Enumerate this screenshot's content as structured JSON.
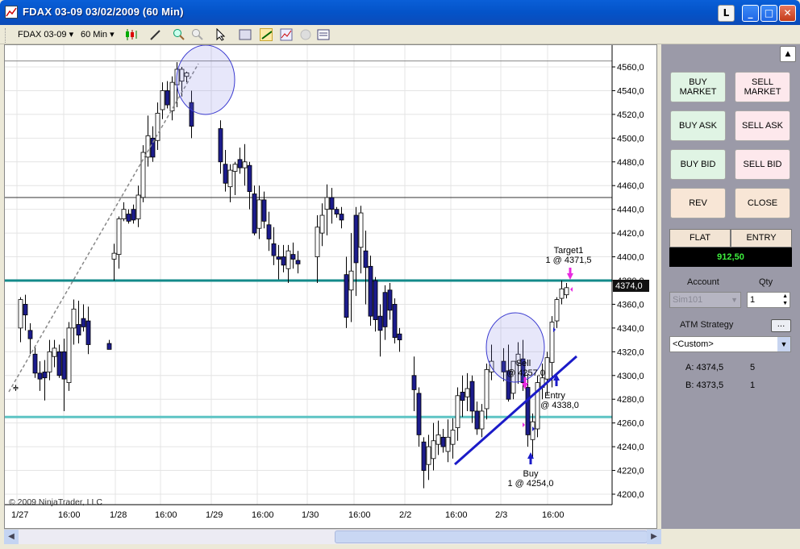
{
  "window": {
    "title": "FDAX 03-09  03/02/2009 (60 Min)",
    "lock_label": "L"
  },
  "toolbar": {
    "instrument": "FDAX 03-09",
    "interval": "60 Min"
  },
  "chart": {
    "copyright": "© 2009 NinjaTrader, LLC",
    "price_labels": [
      "4560,0",
      "4540,0",
      "4520,0",
      "4500,0",
      "4480,0",
      "4460,0",
      "4440,0",
      "4420,0",
      "4400,0",
      "4380,0",
      "4360,0",
      "4340,0",
      "4320,0",
      "4300,0",
      "4280,0",
      "4260,0",
      "4240,0",
      "4220,0",
      "4200,0"
    ],
    "last_price": "4374,0",
    "time_labels": [
      "1/27",
      "16:00",
      "1/28",
      "16:00",
      "1/29",
      "16:00",
      "1/30",
      "16:00",
      "2/2",
      "16:00",
      "2/3",
      "16:00"
    ],
    "annotations": {
      "target_l1": "Target1",
      "target_l2": "1 @ 4371,5",
      "sell_l1": "Sell",
      "sell_l2": "@ 4257,0",
      "entry_l1": "Entry",
      "entry_l2": "@ 4338,0",
      "buy_l1": "Buy",
      "buy_l2": "1 @ 4254,0"
    }
  },
  "chart_data": {
    "type": "candlestick",
    "ylim": [
      4195,
      4570
    ],
    "hlines": [
      4565,
      4450,
      4380,
      4265
    ],
    "candles": [
      [
        4289,
        4292,
        4287,
        4290
      ],
      [
        4340,
        4366,
        4328,
        4364
      ],
      [
        4360,
        4368,
        4338,
        4351
      ],
      [
        4338,
        4344,
        4318,
        4331
      ],
      [
        4318,
        4324,
        4298,
        4302
      ],
      [
        4302,
        4312,
        4287,
        4297
      ],
      [
        4303,
        4313,
        4279,
        4298
      ],
      [
        4303,
        4330,
        4296,
        4320
      ],
      [
        4316,
        4330,
        4307,
        4323
      ],
      [
        4320,
        4326,
        4298,
        4300
      ],
      [
        4320,
        4331,
        4270,
        4297
      ],
      [
        4294,
        4345,
        4287,
        4340
      ],
      [
        4340,
        4364,
        4326,
        4356
      ],
      [
        4343,
        4363,
        4327,
        4334
      ],
      [
        4348,
        4360,
        4337,
        4341
      ],
      [
        4346,
        4358,
        4318,
        4326
      ],
      [
        4327,
        4330,
        4322,
        4322
      ],
      [
        4398,
        4411,
        4380,
        4403
      ],
      [
        4402,
        4434,
        4390,
        4432
      ],
      [
        4432,
        4446,
        4430,
        4440
      ],
      [
        4436,
        4440,
        4428,
        4430
      ],
      [
        4440,
        4444,
        4428,
        4431
      ],
      [
        4432,
        4460,
        4425,
        4452
      ],
      [
        4450,
        4494,
        4446,
        4488
      ],
      [
        4484,
        4519,
        4476,
        4502
      ],
      [
        4500,
        4510,
        4480,
        4484
      ],
      [
        4498,
        4530,
        4490,
        4521
      ],
      [
        4524,
        4547,
        4516,
        4540
      ],
      [
        4540,
        4548,
        4525,
        4528
      ],
      [
        4523,
        4552,
        4515,
        4547
      ],
      [
        4545,
        4564,
        4526,
        4558
      ],
      [
        4548,
        4560,
        4535,
        4558
      ],
      [
        4552,
        4556,
        4547,
        4555
      ],
      [
        4530,
        4540,
        4500,
        4510
      ],
      [
        4508,
        4515,
        4470,
        4480
      ],
      [
        4478,
        4490,
        4455,
        4462
      ],
      [
        4459,
        4478,
        4446,
        4473
      ],
      [
        4472,
        4480,
        4452,
        4478
      ],
      [
        4482,
        4492,
        4470,
        4475
      ],
      [
        4475,
        4495,
        4460,
        4480
      ],
      [
        4477,
        4480,
        4440,
        4455
      ],
      [
        4453,
        4460,
        4418,
        4420
      ],
      [
        4424,
        4460,
        4415,
        4448
      ],
      [
        4448,
        4455,
        4424,
        4430
      ],
      [
        4427,
        4438,
        4405,
        4415
      ],
      [
        4411,
        4425,
        4393,
        4401
      ],
      [
        4400,
        4410,
        4381,
        4398
      ],
      [
        4400,
        4410,
        4387,
        4393
      ],
      [
        4390,
        4410,
        4378,
        4405
      ],
      [
        4402,
        4412,
        4390,
        4398
      ],
      [
        4397,
        4405,
        4386,
        4394
      ],
      [
        4400,
        4435,
        4378,
        4425
      ],
      [
        4420,
        4445,
        4409,
        4435
      ],
      [
        4440,
        4461,
        4418,
        4450
      ],
      [
        4450,
        4458,
        4428,
        4440
      ],
      [
        4440,
        4442,
        4433,
        4436
      ],
      [
        4436,
        4442,
        4424,
        4431
      ],
      [
        4385,
        4400,
        4340,
        4349
      ],
      [
        4372,
        4420,
        4345,
        4388
      ],
      [
        4435,
        4442,
        4367,
        4395
      ],
      [
        4408,
        4443,
        4386,
        4437
      ],
      [
        4405,
        4422,
        4360,
        4391
      ],
      [
        4392,
        4401,
        4342,
        4350
      ],
      [
        4380,
        4383,
        4337,
        4347
      ],
      [
        4350,
        4360,
        4316,
        4338
      ],
      [
        4370,
        4376,
        4330,
        4341
      ],
      [
        4372,
        4378,
        4347,
        4355
      ],
      [
        4360,
        4365,
        4327,
        4332
      ],
      [
        4335,
        4340,
        4320,
        4330
      ],
      [
        4300,
        4316,
        4270,
        4288
      ],
      [
        4285,
        4290,
        4240,
        4250
      ],
      [
        4244,
        4248,
        4205,
        4220
      ],
      [
        4225,
        4250,
        4212,
        4240
      ],
      [
        4230,
        4260,
        4220,
        4245
      ],
      [
        4242,
        4262,
        4233,
        4250
      ],
      [
        4248,
        4255,
        4235,
        4240
      ],
      [
        4236,
        4263,
        4227,
        4248
      ],
      [
        4242,
        4264,
        4230,
        4254
      ],
      [
        4256,
        4290,
        4245,
        4283
      ],
      [
        4286,
        4300,
        4265,
        4279
      ],
      [
        4282,
        4302,
        4270,
        4289
      ],
      [
        4295,
        4300,
        4260,
        4270
      ],
      [
        4270,
        4278,
        4250,
        4255
      ],
      [
        4255,
        4276,
        4248,
        4270
      ],
      [
        4272,
        4310,
        4263,
        4305
      ],
      [
        4303,
        4326,
        4296,
        4312
      ],
      [
        4312,
        4323,
        4295,
        4303
      ],
      [
        4304,
        4326,
        4278,
        4280
      ],
      [
        4285,
        4310,
        4280,
        4312
      ],
      [
        4310,
        4328,
        4293,
        4318
      ],
      [
        4314,
        4330,
        4287,
        4294
      ],
      [
        4290,
        4302,
        4240,
        4250
      ],
      [
        4246,
        4268,
        4230,
        4261
      ],
      [
        4255,
        4300,
        4248,
        4294
      ],
      [
        4290,
        4310,
        4280,
        4298
      ],
      [
        4297,
        4320,
        4284,
        4315
      ],
      [
        4311,
        4350,
        4290,
        4345
      ],
      [
        4346,
        4366,
        4340,
        4364
      ],
      [
        4365,
        4380,
        4360,
        4373
      ],
      [
        4368,
        4378,
        4365,
        4374
      ]
    ]
  },
  "panel": {
    "buy_market": [
      "BUY",
      "MARKET"
    ],
    "sell_market": [
      "SELL",
      "MARKET"
    ],
    "buy_ask": "BUY ASK",
    "sell_ask": "SELL ASK",
    "buy_bid": "BUY BID",
    "sell_bid": "SELL BID",
    "rev": "REV",
    "close": "CLOSE",
    "position": "FLAT",
    "entry": "ENTRY",
    "pnl": "912,50",
    "account_label": "Account",
    "qty_label": "Qty",
    "account_value": "Sim101",
    "qty_value": "1",
    "atm_label": "ATM Strategy",
    "atm_dots": "...",
    "atm_value": "<Custom>",
    "ask_label": "A: 4374,5",
    "ask_size": "5",
    "bid_label": "B: 4373,5",
    "bid_size": "1"
  },
  "colors": {
    "bear": "#1c1c8c",
    "bull": "#ffffff",
    "teal": "#138a8a",
    "cyan": "#5ec4c4",
    "trend": "#1b1bc8",
    "pink": "#e82ae0"
  }
}
